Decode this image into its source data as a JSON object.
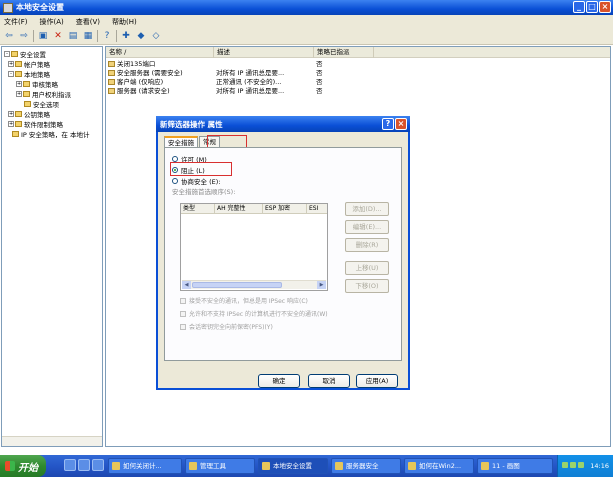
{
  "window": {
    "title": "本地安全设置"
  },
  "menu": [
    "文件(F)",
    "操作(A)",
    "查看(V)",
    "帮助(H)"
  ],
  "toolbar_icons": [
    "back-icon",
    "forward-icon",
    "up-icon",
    "delete-icon",
    "properties-icon",
    "export-icon",
    "help-icon",
    "new-policy-icon",
    "assign-icon",
    "unassign-icon"
  ],
  "tree": [
    {
      "label": "安全设置",
      "level": 0,
      "expander": "-"
    },
    {
      "label": "帐户策略",
      "level": 1,
      "expander": "+"
    },
    {
      "label": "本地策略",
      "level": 1,
      "expander": "-"
    },
    {
      "label": "审核策略",
      "level": 2,
      "expander": "+"
    },
    {
      "label": "用户权利指派",
      "level": 2,
      "expander": "+"
    },
    {
      "label": "安全选项",
      "level": 2,
      "expander": ""
    },
    {
      "label": "公钥策略",
      "level": 1,
      "expander": "+"
    },
    {
      "label": "软件限制策略",
      "level": 1,
      "expander": "+"
    },
    {
      "label": "IP 安全策略，在 本地计",
      "level": 1,
      "expander": ""
    }
  ],
  "list": {
    "columns": [
      "名称 /",
      "描述",
      "策略已指派"
    ],
    "rows": [
      {
        "name": "关闭135端口",
        "desc": "",
        "assigned": "否"
      },
      {
        "name": "安全服务器 (需要安全)",
        "desc": "对所有 IP 通讯总是要...",
        "assigned": "否"
      },
      {
        "name": "客户端 (仅响应)",
        "desc": "正常通讯 (不安全的)...",
        "assigned": "否"
      },
      {
        "name": "服务器 (请求安全)",
        "desc": "对所有 IP 通讯总是要...",
        "assigned": "否"
      }
    ]
  },
  "dialog": {
    "title": "新筛选器操作 属性",
    "tabs": [
      "安全措施",
      "常规"
    ],
    "radios": [
      {
        "label": "许可 (M)",
        "selected": false
      },
      {
        "label": "阻止 (L)",
        "selected": true
      },
      {
        "label": "协商安全 (E):",
        "selected": false
      }
    ],
    "order_label": "安全措施首选顺序(S):",
    "inner_columns": [
      "类型",
      "AH 完整性",
      "ESP 加密",
      "ESI"
    ],
    "side_buttons": [
      "添加(D)...",
      "编辑(E)...",
      "删除(R)",
      "上移(U)",
      "下移(O)"
    ],
    "checks": [
      "接受不安全的通讯，但总是用 IPSec 响应(C)",
      "允许和不支持 IPSec 的计算机进行不安全的通讯(W)",
      "会话密钥完全向前保密(PFS)(Y)"
    ],
    "buttons": {
      "ok": "确定",
      "cancel": "取消",
      "apply": "应用(A)"
    }
  },
  "taskbar": {
    "start": "开始",
    "tasks": [
      "如何关闭计...",
      "管理工具",
      "本地安全设置",
      "服务器安全",
      "如何在Win2...",
      "11 - 画图"
    ],
    "clock": "14:16"
  }
}
